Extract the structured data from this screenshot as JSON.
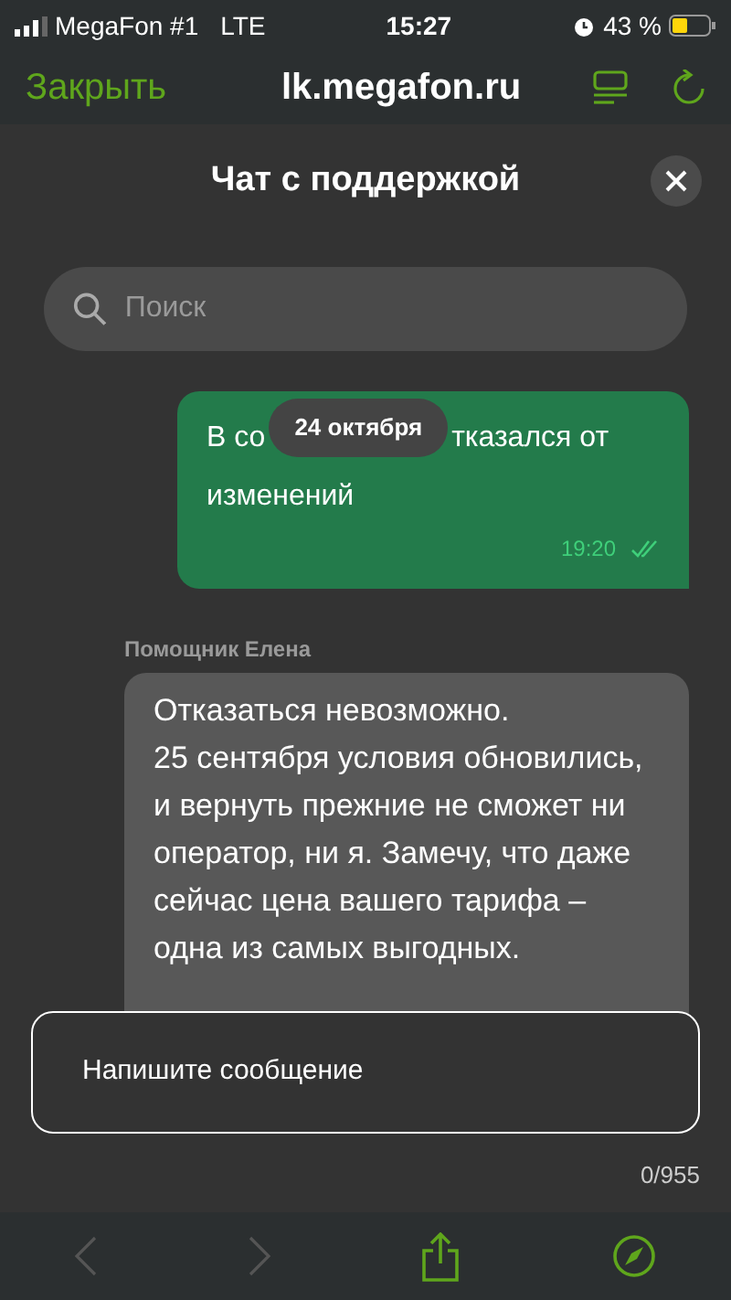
{
  "status_bar": {
    "carrier": "MegaFon #1",
    "network": "LTE",
    "time": "15:27",
    "battery": "43 %"
  },
  "browser_bar": {
    "close": "Закрыть",
    "url": "lk.megafon.ru"
  },
  "chat": {
    "title": "Чат с поддержкой",
    "search": {
      "placeholder": "Поиск"
    },
    "date_pill": "24 октября",
    "messages": [
      {
        "kind": "outgoing",
        "line_parts": [
          [
            "В со",
            "тказался от"
          ],
          [
            "изменений"
          ]
        ],
        "time": "19:20",
        "read": true
      },
      {
        "kind": "incoming",
        "sender": "Помощник Елена",
        "text": "Отказаться невозможно.\n25 сентября условия обновились, и вернуть прежние не сможет ни оператор, ни я. Замечу, что даже сейчас цена вашего тарифа – одна из самых выгодных."
      }
    ],
    "composer": {
      "placeholder": "Напишите сообщение",
      "counter": "0/955"
    }
  },
  "toolbar": {
    "back_enabled": false,
    "forward_enabled": false
  }
}
